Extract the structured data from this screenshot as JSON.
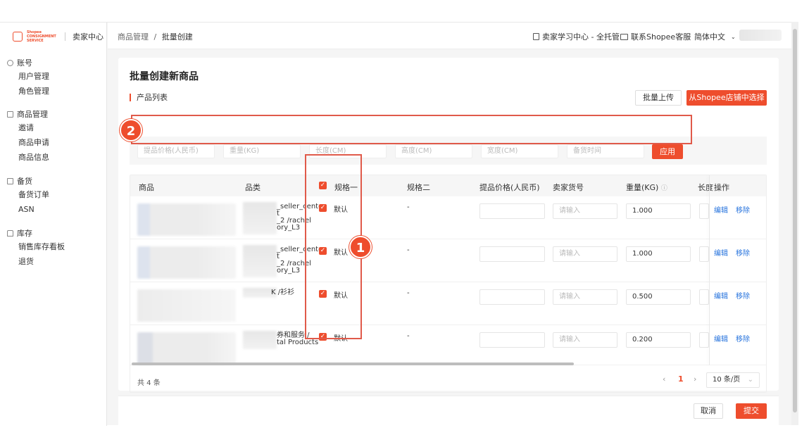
{
  "sidebar": {
    "logo_text": "Shopee CONSIGNMENT SERVICE",
    "title": "卖家中心",
    "groups": [
      {
        "label": "账号",
        "items": [
          "用户管理",
          "角色管理"
        ]
      },
      {
        "label": "商品管理",
        "items": [
          "邀请",
          "商品申请",
          "商品信息"
        ]
      },
      {
        "label": "备货",
        "items": [
          "备货订单",
          "ASN"
        ]
      },
      {
        "label": "库存",
        "items": [
          "销售库存看板",
          "退货"
        ]
      }
    ]
  },
  "header": {
    "breadcrumb_parent": "商品管理",
    "breadcrumb_sep": "/",
    "breadcrumb_current": "批量创建",
    "learning_center": "卖家学习中心 - 全托管",
    "contact": "联系Shopee客服",
    "language": "简体中文"
  },
  "main": {
    "title": "批量创建新商品",
    "section": "产品列表",
    "bulk_upload": "批量上传",
    "select_from_shop": "从Shopee店铺中选择",
    "bulk_fields": [
      "提品价格(人民币)",
      "重量(KG)",
      "长度(CM)",
      "高度(CM)",
      "宽度(CM)",
      "备货时间"
    ],
    "apply": "应用",
    "columns": [
      "商品",
      "品类",
      "规格一",
      "规格二",
      "提品价格(人民币)",
      "卖家货号",
      "重量(KG)",
      "长度",
      "操作"
    ],
    "rows": [
      {
        "category": "_seller_center\nt\n_2 /rachel\nory_L3",
        "spec1": "默认",
        "spec2": "-",
        "sku_placeholder": "请输入",
        "weight": "1.000"
      },
      {
        "category": "_seller_center\nt\n_2 /rachel\nory_L3",
        "spec1": "默认",
        "spec2": "-",
        "sku_placeholder": "请输入",
        "weight": "1.000"
      },
      {
        "category": "K /衫衫",
        "spec1": "默认",
        "spec2": "-",
        "sku_placeholder": "请输入",
        "weight": "0.500"
      },
      {
        "category": "券和服务 /\ntal Products",
        "spec1": "默认",
        "spec2": "-",
        "sku_placeholder": "请输入",
        "weight": "0.200"
      }
    ],
    "edit": "编辑",
    "remove": "移除",
    "total": "共 4 条",
    "page": "1",
    "page_size": "10 条/页"
  },
  "annotations": {
    "badge1": "1",
    "badge2": "2"
  },
  "footer": {
    "cancel": "取消",
    "submit": "提交"
  },
  "colors": {
    "accent": "#ee4d2d",
    "link": "#2673dd"
  }
}
